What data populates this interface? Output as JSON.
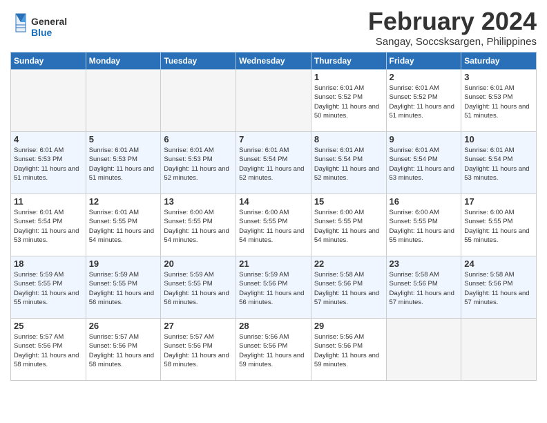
{
  "header": {
    "logo_line1": "General",
    "logo_line2": "Blue",
    "month_title": "February 2024",
    "location": "Sangay, Soccsksargen, Philippines"
  },
  "days_of_week": [
    "Sunday",
    "Monday",
    "Tuesday",
    "Wednesday",
    "Thursday",
    "Friday",
    "Saturday"
  ],
  "weeks": [
    [
      {
        "num": "",
        "data": ""
      },
      {
        "num": "",
        "data": ""
      },
      {
        "num": "",
        "data": ""
      },
      {
        "num": "",
        "data": ""
      },
      {
        "num": "1",
        "data": "Sunrise: 6:01 AM\nSunset: 5:52 PM\nDaylight: 11 hours and 50 minutes."
      },
      {
        "num": "2",
        "data": "Sunrise: 6:01 AM\nSunset: 5:52 PM\nDaylight: 11 hours and 51 minutes."
      },
      {
        "num": "3",
        "data": "Sunrise: 6:01 AM\nSunset: 5:53 PM\nDaylight: 11 hours and 51 minutes."
      }
    ],
    [
      {
        "num": "4",
        "data": "Sunrise: 6:01 AM\nSunset: 5:53 PM\nDaylight: 11 hours and 51 minutes."
      },
      {
        "num": "5",
        "data": "Sunrise: 6:01 AM\nSunset: 5:53 PM\nDaylight: 11 hours and 51 minutes."
      },
      {
        "num": "6",
        "data": "Sunrise: 6:01 AM\nSunset: 5:53 PM\nDaylight: 11 hours and 52 minutes."
      },
      {
        "num": "7",
        "data": "Sunrise: 6:01 AM\nSunset: 5:54 PM\nDaylight: 11 hours and 52 minutes."
      },
      {
        "num": "8",
        "data": "Sunrise: 6:01 AM\nSunset: 5:54 PM\nDaylight: 11 hours and 52 minutes."
      },
      {
        "num": "9",
        "data": "Sunrise: 6:01 AM\nSunset: 5:54 PM\nDaylight: 11 hours and 53 minutes."
      },
      {
        "num": "10",
        "data": "Sunrise: 6:01 AM\nSunset: 5:54 PM\nDaylight: 11 hours and 53 minutes."
      }
    ],
    [
      {
        "num": "11",
        "data": "Sunrise: 6:01 AM\nSunset: 5:54 PM\nDaylight: 11 hours and 53 minutes."
      },
      {
        "num": "12",
        "data": "Sunrise: 6:01 AM\nSunset: 5:55 PM\nDaylight: 11 hours and 54 minutes."
      },
      {
        "num": "13",
        "data": "Sunrise: 6:00 AM\nSunset: 5:55 PM\nDaylight: 11 hours and 54 minutes."
      },
      {
        "num": "14",
        "data": "Sunrise: 6:00 AM\nSunset: 5:55 PM\nDaylight: 11 hours and 54 minutes."
      },
      {
        "num": "15",
        "data": "Sunrise: 6:00 AM\nSunset: 5:55 PM\nDaylight: 11 hours and 54 minutes."
      },
      {
        "num": "16",
        "data": "Sunrise: 6:00 AM\nSunset: 5:55 PM\nDaylight: 11 hours and 55 minutes."
      },
      {
        "num": "17",
        "data": "Sunrise: 6:00 AM\nSunset: 5:55 PM\nDaylight: 11 hours and 55 minutes."
      }
    ],
    [
      {
        "num": "18",
        "data": "Sunrise: 5:59 AM\nSunset: 5:55 PM\nDaylight: 11 hours and 55 minutes."
      },
      {
        "num": "19",
        "data": "Sunrise: 5:59 AM\nSunset: 5:55 PM\nDaylight: 11 hours and 56 minutes."
      },
      {
        "num": "20",
        "data": "Sunrise: 5:59 AM\nSunset: 5:55 PM\nDaylight: 11 hours and 56 minutes."
      },
      {
        "num": "21",
        "data": "Sunrise: 5:59 AM\nSunset: 5:56 PM\nDaylight: 11 hours and 56 minutes."
      },
      {
        "num": "22",
        "data": "Sunrise: 5:58 AM\nSunset: 5:56 PM\nDaylight: 11 hours and 57 minutes."
      },
      {
        "num": "23",
        "data": "Sunrise: 5:58 AM\nSunset: 5:56 PM\nDaylight: 11 hours and 57 minutes."
      },
      {
        "num": "24",
        "data": "Sunrise: 5:58 AM\nSunset: 5:56 PM\nDaylight: 11 hours and 57 minutes."
      }
    ],
    [
      {
        "num": "25",
        "data": "Sunrise: 5:57 AM\nSunset: 5:56 PM\nDaylight: 11 hours and 58 minutes."
      },
      {
        "num": "26",
        "data": "Sunrise: 5:57 AM\nSunset: 5:56 PM\nDaylight: 11 hours and 58 minutes."
      },
      {
        "num": "27",
        "data": "Sunrise: 5:57 AM\nSunset: 5:56 PM\nDaylight: 11 hours and 58 minutes."
      },
      {
        "num": "28",
        "data": "Sunrise: 5:56 AM\nSunset: 5:56 PM\nDaylight: 11 hours and 59 minutes."
      },
      {
        "num": "29",
        "data": "Sunrise: 5:56 AM\nSunset: 5:56 PM\nDaylight: 11 hours and 59 minutes."
      },
      {
        "num": "",
        "data": ""
      },
      {
        "num": "",
        "data": ""
      }
    ]
  ]
}
